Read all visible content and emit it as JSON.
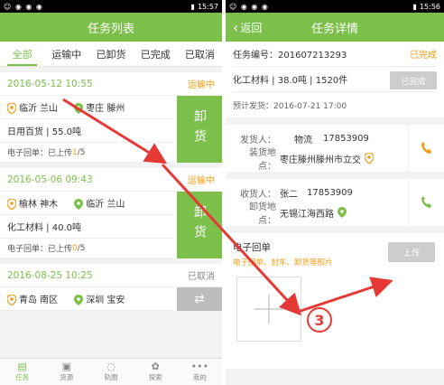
{
  "status_bar": {
    "left_icons": "☺ ◉ ◉ ◉",
    "time_left": "15:57",
    "time_right": "15:56"
  },
  "list_screen": {
    "title": "任务列表",
    "tabs": [
      "全部",
      "运输中",
      "已卸货",
      "已完成",
      "已取消"
    ],
    "cards": [
      {
        "date": "2016-05-12 10:55",
        "status": "运输中",
        "origin": "临沂 兰山",
        "destination": "枣庄 滕州",
        "cargo": "日用百货 | 55.0吨",
        "receipt_label": "电子回单：已上传",
        "uploaded": "1",
        "total": "/5",
        "action": "卸货"
      },
      {
        "date": "2016-05-06 09:43",
        "status": "运输中",
        "origin": "榆林 神木",
        "destination": "临沂 兰山",
        "cargo": "化工材料 | 40.0吨",
        "receipt_label": "电子回单：已上传",
        "uploaded": "0",
        "total": "/5",
        "action": "卸货"
      },
      {
        "date": "2016-08-25 10:25",
        "status": "已取消",
        "origin": "青岛 南区",
        "destination": "深圳 宝安",
        "action": "⇄"
      }
    ]
  },
  "detail_screen": {
    "back_label": "返回",
    "title": "任务详情",
    "task_no": "任务编号：201607213293",
    "task_status": "已完成",
    "cargo": "化工材料 | 38.0吨 | 1520件",
    "done_button": "已完成",
    "planned_delivery": "预计发货：2016-07-21 17:00",
    "shipper": {
      "label": "发货人：",
      "name": "物流",
      "phone": "17853909"
    },
    "load_place": {
      "label": "装货地点：",
      "value": "枣庄滕州滕州市立交"
    },
    "receiver": {
      "label": "收货人：",
      "name": "张二",
      "phone": "17853909"
    },
    "unload_place": {
      "label": "卸货地点：",
      "value": "无锡江海西路"
    },
    "receipt_title": "电子回单",
    "receipt_hint": "电子回单、封车、卸货等照片",
    "upload_button": "上传",
    "step_number": "3"
  },
  "bottom_nav": [
    {
      "label": "任务",
      "icon": "task-icon",
      "glyph": "▤"
    },
    {
      "label": "货源",
      "icon": "box-icon",
      "glyph": "▣"
    },
    {
      "label": "轨圈",
      "icon": "chat-icon",
      "glyph": "◌"
    },
    {
      "label": "探索",
      "icon": "paw-icon",
      "glyph": "✿"
    },
    {
      "label": "我的",
      "icon": "more-icon",
      "glyph": "•••"
    }
  ],
  "colors": {
    "accent": "#7cc04b",
    "orange": "#f39c12",
    "annotation_red": "#e53935"
  }
}
